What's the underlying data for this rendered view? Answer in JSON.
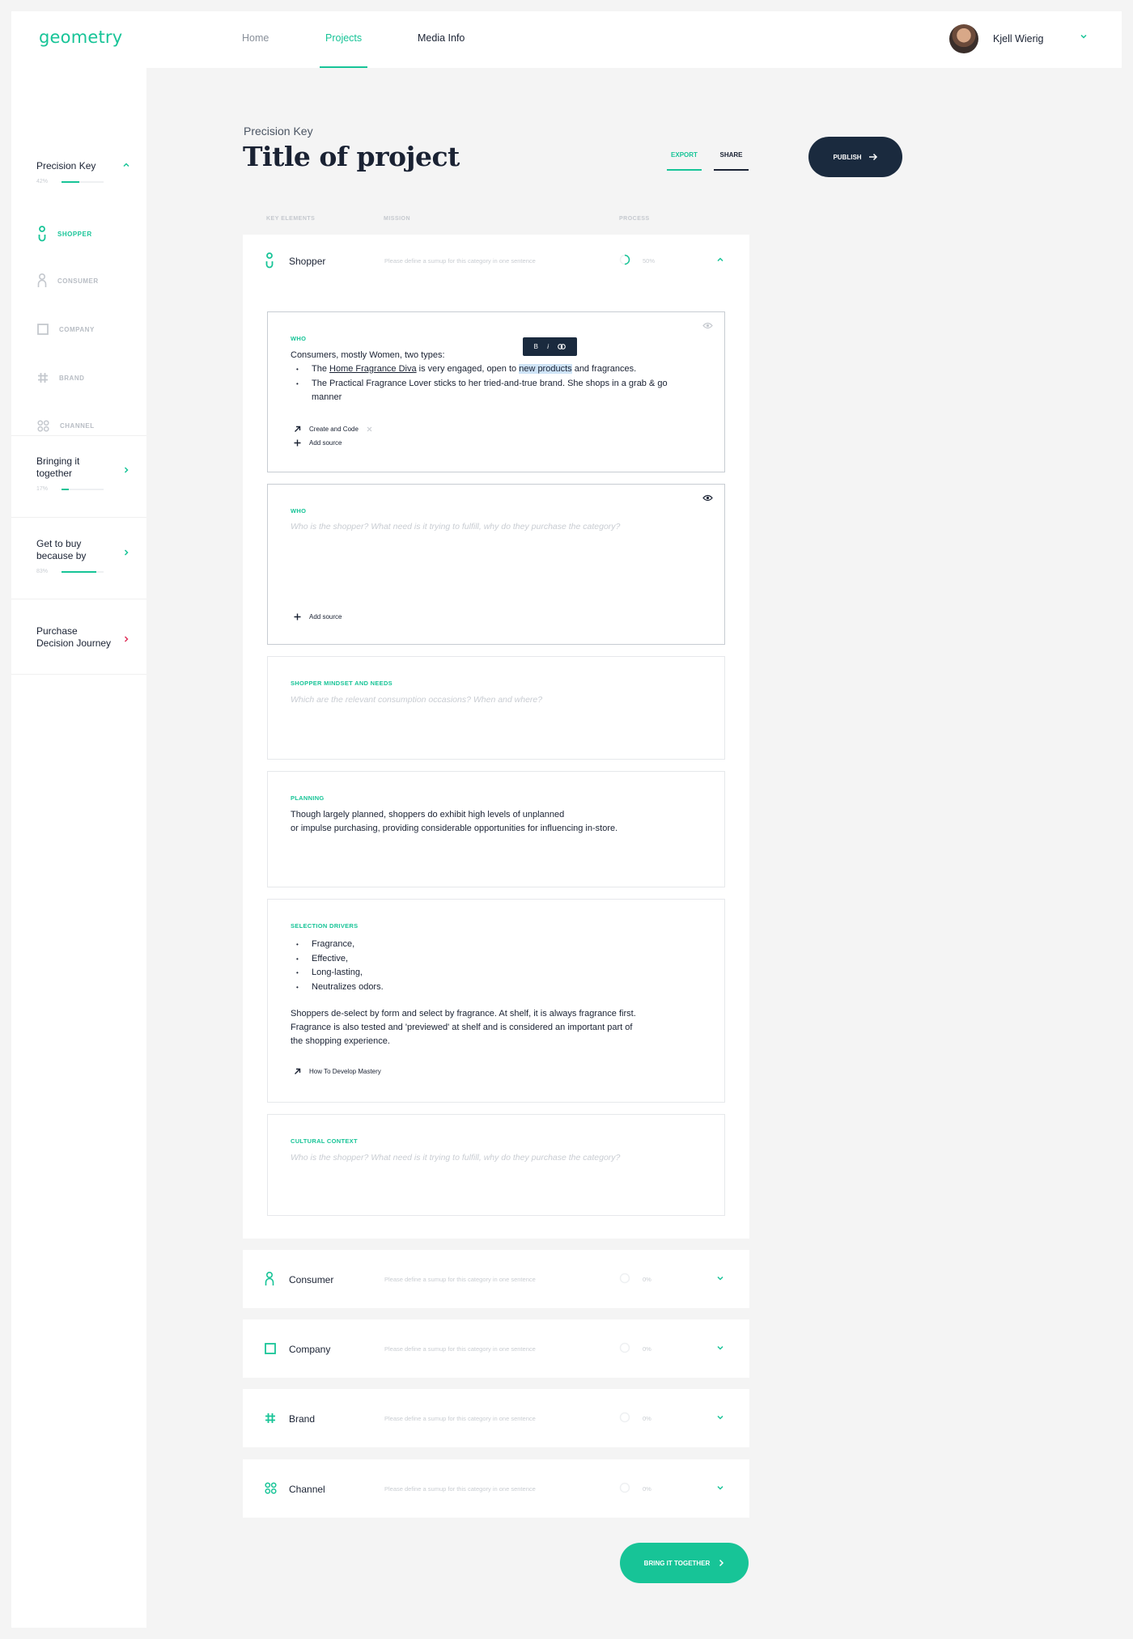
{
  "header": {
    "logo": "geometry",
    "nav": [
      {
        "label": "Home"
      },
      {
        "label": "Projects",
        "active": true
      },
      {
        "label": "Media Info"
      }
    ],
    "user": {
      "name": "Kjell Wierig"
    }
  },
  "sidebar": {
    "sections": [
      {
        "title": "Precision Key",
        "percent": "42%",
        "progress": 0.42,
        "expanded": true
      },
      {
        "title": "Bringing it together",
        "percent": "17%",
        "progress": 0.17
      },
      {
        "title": "Get to buy because by",
        "percent": "83%",
        "progress": 0.83
      },
      {
        "title": "Purchase Decision Journey"
      }
    ],
    "items": [
      {
        "label": "SHOPPER",
        "icon": "shopper-icon",
        "active": true
      },
      {
        "label": "CONSUMER",
        "icon": "consumer-icon"
      },
      {
        "label": "COMPANY",
        "icon": "company-icon"
      },
      {
        "label": "BRAND",
        "icon": "hash-icon"
      },
      {
        "label": "CHANNEL",
        "icon": "channel-icon"
      }
    ]
  },
  "page": {
    "eyebrow": "Precision Key",
    "title": "Title of project",
    "export_label": "EXPORT",
    "share_label": "SHARE",
    "publish_label": "PUBLISH",
    "columns": {
      "key_elements": "KEY ELEMENTS",
      "mission": "MISSION",
      "process": "PROCESS"
    }
  },
  "categories": [
    {
      "title": "Shopper",
      "mission": "Please define a sumup for this category in one sentence",
      "percent": "50%",
      "expanded": true
    },
    {
      "title": "Consumer",
      "mission": "Please define a sumup for this category in one sentence",
      "percent": "0%"
    },
    {
      "title": "Company",
      "mission": "Please define a sumup for this category in one sentence",
      "percent": "0%"
    },
    {
      "title": "Brand",
      "mission": "Please define a sumup for this category in one sentence",
      "percent": "0%"
    },
    {
      "title": "Channel",
      "mission": "Please define a sumup for this category in one sentence",
      "percent": "0%"
    }
  ],
  "cards": {
    "who1": {
      "label": "WHO",
      "intro": "Consumers, mostly Women, two types:",
      "b1_pre": "The ",
      "b1_link": "Home Fragrance Diva",
      "b1_mid": " is very engaged, open to ",
      "b1_hl": "new products",
      "b1_post": " and fragrances.",
      "b2": "The Practical Fragrance Lover sticks to her tried-and-true brand. She shops in a grab & go manner",
      "format": {
        "bold": "B",
        "italic": "i"
      },
      "source": "Create and Code",
      "add_source": "Add source"
    },
    "who2": {
      "label": "WHO",
      "placeholder": "Who is the shopper? What need is it trying to fulfill, why do they purchase the category?",
      "add_source": "Add source"
    },
    "mindset": {
      "label": "SHOPPER MINDSET AND NEEDS",
      "placeholder": "Which are the relevant consumption occasions? When and where?"
    },
    "planning": {
      "label": "PLANNING",
      "line1": "Though largely planned, shoppers do exhibit high levels of unplanned",
      "line2": "or impulse purchasing, providing considerable opportunities for influencing in-store."
    },
    "selection": {
      "label": "SELECTION DRIVERS",
      "bullets": [
        "Fragrance,",
        "Effective,",
        "Long-lasting,",
        "Neutralizes odors."
      ],
      "p1": "Shoppers de-select by form and select by fragrance. At shelf, it is always fragrance first.",
      "p2": "Fragrance is also tested and 'previewed' at shelf and is considered an important part of",
      "p3": "the shopping experience.",
      "source": "How To Develop Mastery"
    },
    "cultural": {
      "label": "CULTURAL CONTEXT",
      "placeholder": "Who is the shopper? What need is it trying to fulfill, why do they purchase the category?"
    }
  },
  "footer": {
    "bring_label": "BRING IT TOGETHER"
  },
  "colors": {
    "accent": "#17c497",
    "dark": "#1a2a3e",
    "alert": "#e0325a"
  }
}
